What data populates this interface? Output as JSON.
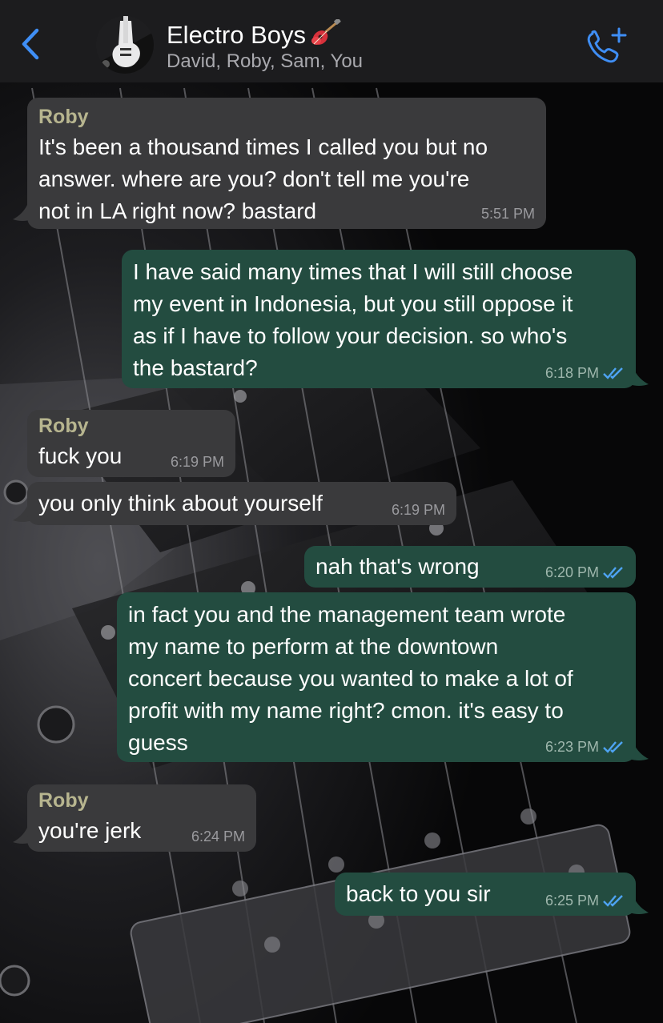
{
  "header": {
    "back_icon": "chevron-left-icon",
    "title": "Electro Boys",
    "title_emoji": "guitar-emoji",
    "participants": "David, Roby, Sam, You",
    "call_icon": "phone-plus-icon"
  },
  "colors": {
    "header_bg": "#1c1c1e",
    "incoming_bubble": "#3a3a3c",
    "outgoing_bubble": "#234c40",
    "sender_name": "#b7b58f",
    "accent_blue": "#3f8ef5",
    "read_ticks": "#4ea3f2"
  },
  "messages": [
    {
      "direction": "in",
      "sender": "Roby",
      "text": "It's been a thousand times I called you but no\nanswer. where are you? don't tell me you're\nnot in LA right now? bastard",
      "time": "5:51 PM"
    },
    {
      "direction": "out",
      "text": "I have said many times that I will still choose\nmy event in Indonesia, but you still oppose it\nas if I have to follow your decision. so who's\nthe bastard?",
      "time": "6:18 PM",
      "status": "read"
    },
    {
      "direction": "in",
      "sender": "Roby",
      "text": "fuck you",
      "time": "6:19 PM"
    },
    {
      "direction": "in",
      "text": "you only think about yourself",
      "time": "6:19 PM"
    },
    {
      "direction": "out",
      "text": "nah that's wrong",
      "time": "6:20 PM",
      "status": "read"
    },
    {
      "direction": "out",
      "text": "in fact you and the management team wrote\nmy name to perform at the downtown\nconcert because you wanted to make a lot of\nprofit with my name right? cmon. it's easy to\nguess",
      "time": "6:23 PM",
      "status": "read"
    },
    {
      "direction": "in",
      "sender": "Roby",
      "text": "you're jerk",
      "time": "6:24 PM"
    },
    {
      "direction": "out",
      "text": "back to you sir",
      "time": "6:25 PM",
      "status": "read"
    }
  ]
}
